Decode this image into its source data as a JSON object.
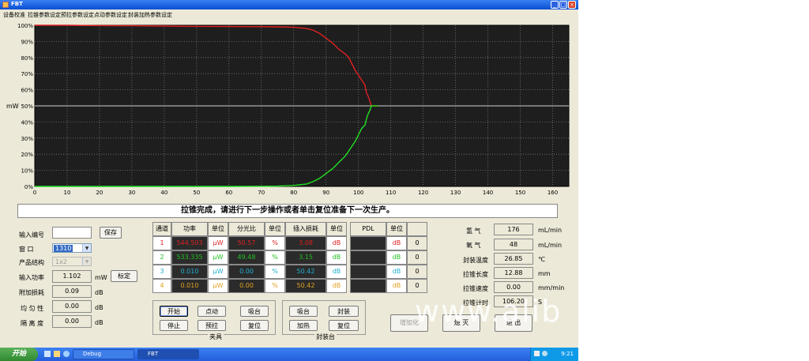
{
  "window": {
    "title": "FBT",
    "min": "_",
    "max": "□",
    "close": "×"
  },
  "menu": [
    "设备校准",
    "拉锥参数设定",
    "预拉参数设定",
    "点动参数设定",
    "封装加热参数设定"
  ],
  "chart_data": {
    "type": "line",
    "ylabel": "mW",
    "xlim": [
      0,
      165
    ],
    "ylim": [
      0,
      100
    ],
    "x_ticks": [
      0,
      10,
      20,
      30,
      40,
      50,
      60,
      70,
      80,
      90,
      100,
      110,
      120,
      130,
      140,
      150,
      160
    ],
    "y_ticks": [
      "0%",
      "10%",
      "20%",
      "30%",
      "40%",
      "50%",
      "60%",
      "70%",
      "80%",
      "90%",
      "100%"
    ],
    "grid": true,
    "series": [
      {
        "color": "#e02020",
        "x": [
          0,
          10,
          20,
          30,
          40,
          50,
          60,
          70,
          75,
          80,
          84,
          86,
          88,
          90,
          92,
          94,
          96,
          97,
          98,
          99,
          100,
          101,
          102,
          102.5,
          103,
          103.5,
          104,
          106
        ],
        "y": [
          100,
          100,
          99.8,
          99.7,
          99.5,
          99.3,
          99.2,
          99.1,
          99,
          98.8,
          98,
          97,
          95,
          92,
          89,
          85,
          82,
          80,
          76,
          72,
          69,
          66,
          63,
          58,
          56,
          53,
          50,
          50
        ]
      },
      {
        "color": "#20e020",
        "x": [
          0,
          10,
          20,
          30,
          40,
          50,
          60,
          70,
          75,
          80,
          84,
          86,
          88,
          90,
          92,
          94,
          96,
          97,
          98,
          99,
          100,
          101,
          102,
          102.5,
          103,
          103.5,
          104,
          106
        ],
        "y": [
          0,
          0,
          0,
          0,
          0,
          0,
          0,
          0.1,
          0.2,
          0.6,
          1.5,
          3,
          5,
          8,
          11,
          15,
          19,
          22,
          25,
          28,
          32,
          36,
          38,
          42,
          45,
          47,
          50,
          50
        ]
      }
    ],
    "reference_line": 50
  },
  "status_message": "拉锥完成，请进行下一步操作或者单击复位准备下一次生产。",
  "left": {
    "input_number_label": "输入编号",
    "input_number_value": "",
    "save_button": "保存",
    "window_label": "窗    口",
    "window_value": "1310",
    "structure_label": "产品结构",
    "structure_value": "1x2",
    "input_power_label": "输入功率",
    "input_power_value": "1.102",
    "input_power_unit": "mW",
    "calibrate_button": "标定",
    "excess_loss_label": "附加损耗",
    "excess_loss_value": "0.09",
    "excess_loss_unit": "dB",
    "uniformity_label": "均 匀 性",
    "uniformity_value": "0.00",
    "uniformity_unit": "dB",
    "isolation_label": "隔 离 度",
    "isolation_value": "0.00",
    "isolation_unit": "dB"
  },
  "table": {
    "headers": [
      "通道",
      "功率",
      "单位",
      "分光比",
      "单位",
      "插入损耗",
      "单位",
      "PDL",
      "单位",
      ""
    ],
    "rows": [
      {
        "ch": "1",
        "power": "544.503",
        "unit1": "μW",
        "ratio": "50.57",
        "unit2": "%",
        "il": "3.08",
        "unit3": "dB",
        "pdl": "",
        "unit4": "dB",
        "extra": "0",
        "color": "#e02020"
      },
      {
        "ch": "2",
        "power": "533.335",
        "unit1": "μW",
        "ratio": "49.48",
        "unit2": "%",
        "il": "3.15",
        "unit3": "dB",
        "pdl": "",
        "unit4": "dB",
        "extra": "0",
        "color": "#20c020"
      },
      {
        "ch": "3",
        "power": "0.010",
        "unit1": "μW",
        "ratio": "0.00",
        "unit2": "%",
        "il": "50.42",
        "unit3": "dB",
        "pdl": "",
        "unit4": "dB",
        "extra": "0",
        "color": "#20b0d0"
      },
      {
        "ch": "4",
        "power": "0.010",
        "unit1": "μW",
        "ratio": "0.00",
        "unit2": "%",
        "il": "50.42",
        "unit3": "dB",
        "pdl": "",
        "unit4": "dB",
        "extra": "0",
        "color": "#e0a020"
      }
    ]
  },
  "fixture": {
    "caption": "夹具",
    "start": "开始",
    "jog": "点动",
    "suction": "吸台",
    "stop": "停止",
    "prepull": "预拉",
    "reset": "复位"
  },
  "package": {
    "caption": "封装台",
    "suction": "吸台",
    "seal": "封装",
    "heat": "加热",
    "reset": "复位"
  },
  "right": {
    "hydrogen_label": "氢    气",
    "hydrogen_value": "176",
    "hydrogen_unit": "mL/min",
    "oxygen_label": "氧    气",
    "oxygen_value": "48",
    "oxygen_unit": "mL/min",
    "seal_temp_label": "封装温度",
    "seal_temp_value": "26.85",
    "seal_temp_unit": "℃",
    "pull_length_label": "拉锥长度",
    "pull_length_value": "12.88",
    "pull_length_unit": "mm",
    "pull_speed_label": "拉锥速度",
    "pull_speed_value": "0.00",
    "pull_speed_unit": "mm/min",
    "pull_time_label": "拉锥计时",
    "pull_time_value": "106.20",
    "pull_time_unit": "S"
  },
  "bottom_buttons": [
    "增加化",
    "熄 灭",
    "退 出"
  ],
  "watermark": "www.alib",
  "taskbar": {
    "start": "开始",
    "tasks": [
      "Debug",
      "FBT"
    ],
    "clock": "9:21"
  }
}
